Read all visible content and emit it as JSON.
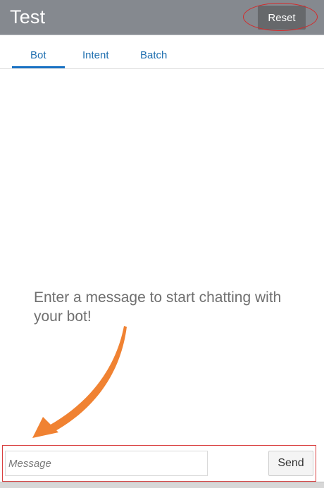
{
  "header": {
    "title": "Test",
    "reset_label": "Reset"
  },
  "tabs": [
    {
      "label": "Bot",
      "active": true
    },
    {
      "label": "Intent",
      "active": false
    },
    {
      "label": "Batch",
      "active": false
    }
  ],
  "main": {
    "empty_message": "Enter a message to start chatting with your bot!"
  },
  "composer": {
    "placeholder": "Message",
    "value": "",
    "send_label": "Send"
  },
  "colors": {
    "header_bg": "#85898f",
    "accent": "#1a73c4",
    "annotation_red": "#d42a2a",
    "annotation_arrow": "#f08232"
  },
  "icons": {
    "arrow": "annotation-arrow-icon"
  }
}
